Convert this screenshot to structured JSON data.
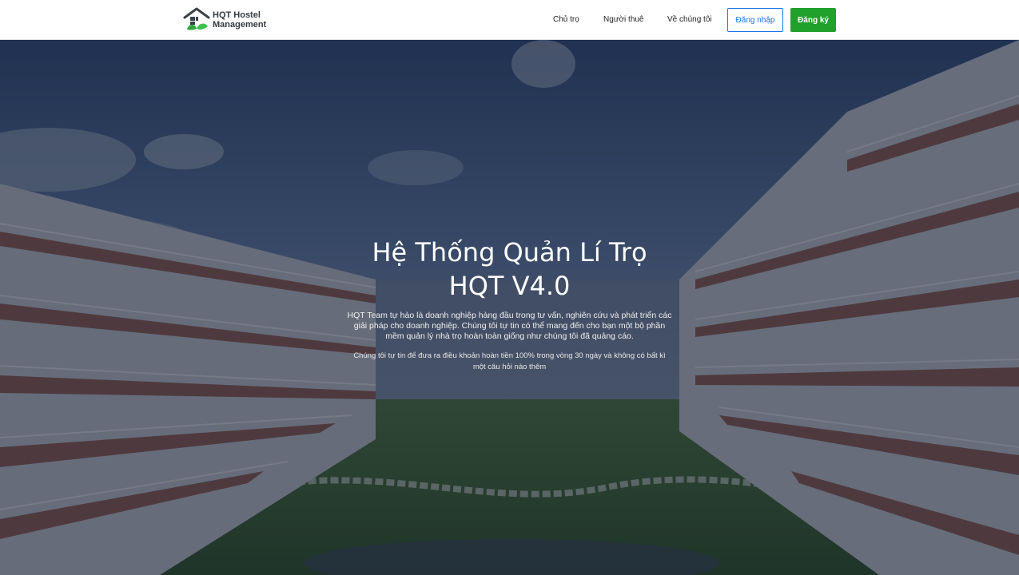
{
  "brand": {
    "line1": "HQT Hostel",
    "line2": "Management",
    "icon": "house-leaf-logo"
  },
  "nav": {
    "links": [
      "Chủ trọ",
      "Người thuê",
      "Về chúng tôi"
    ],
    "login_label": "Đăng nhập",
    "register_label": "Đăng ký"
  },
  "hero": {
    "title_line1": "Hệ Thống Quản Lí Trọ",
    "title_line2": "HQT V4.0",
    "description": "HQT Team tự hào là doanh nghiệp hàng đầu trong tư vấn, nghiên cứu và phát triển các giải pháp cho doanh nghiệp. Chúng tôi tự tin có thể mang đến cho bạn một bộ phần mềm quản lý nhà trọ hoàn toàn giống như chúng tôi đã quảng cáo.",
    "note": "Chúng tôi tự tin để đưa ra điều khoản hoàn tiền 100% trong vòng 30 ngày và không có bất kì một câu hỏi nào thêm"
  },
  "colors": {
    "primary": "#1a73e8",
    "success": "#1fa12c",
    "overlay": "#161e30"
  }
}
